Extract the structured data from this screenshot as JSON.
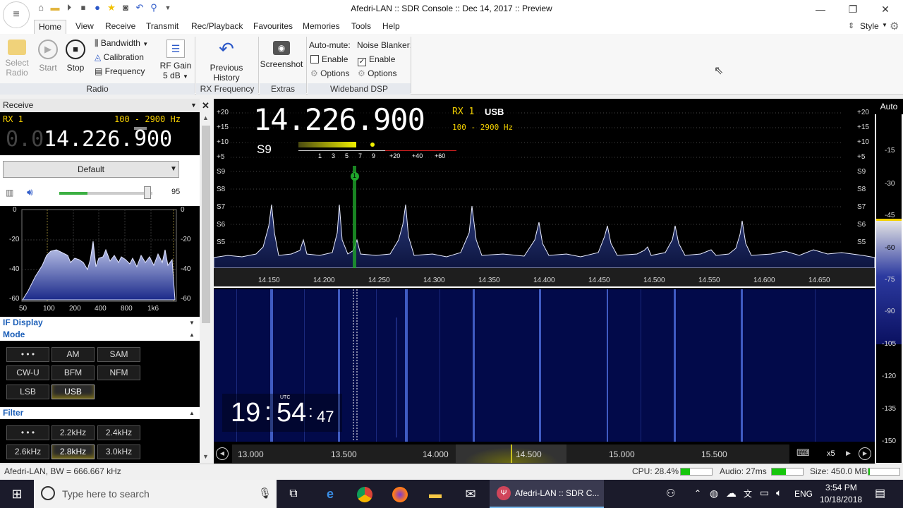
{
  "window": {
    "title": "Afedri-LAN :: SDR Console :: Dec 14, 2017 :: Preview"
  },
  "menu": {
    "tabs": [
      "Home",
      "View",
      "Receive",
      "Transmit",
      "Rec/Playback",
      "Favourites",
      "Memories",
      "Tools",
      "Help"
    ],
    "style_label": "Style"
  },
  "ribbon": {
    "select_radio": "Select\nRadio",
    "start": "Start",
    "stop": "Stop",
    "bandwidth": "Bandwidth",
    "calibration": "Calibration",
    "frequency": "Frequency",
    "rf_gain": "RF Gain",
    "rf_gain_value": "5 dB",
    "previous_history": "Previous History",
    "screenshot": "Screenshot",
    "auto_mute": "Auto-mute:",
    "noise_blanker": "Noise Blanker:",
    "enable": "Enable",
    "options": "Options",
    "group_radio": "Radio",
    "group_rxfreq": "RX Frequency",
    "group_extras": "Extras",
    "group_dsp": "Wideband DSP"
  },
  "receive": {
    "header": "Receive",
    "rx": "RX 1",
    "bw": "100 - 2900 Hz",
    "freq_dim": "0.0",
    "freq_main": "14.226.",
    "freq_cursor": "9",
    "freq_tail": "00",
    "preset": "Default",
    "volume": "95",
    "audio_y": [
      "0",
      "-20",
      "-40",
      "-60"
    ],
    "audio_x": [
      "50",
      "100",
      "200",
      "400",
      "800",
      "1k6"
    ]
  },
  "sections": {
    "if_display": "IF Display",
    "mode": "Mode",
    "filter": "Filter"
  },
  "modes": [
    "• • •",
    "AM",
    "SAM",
    "CW-U",
    "BFM",
    "NFM",
    "LSB",
    "USB"
  ],
  "filters": [
    "• • •",
    "2.2kHz",
    "2.4kHz",
    "2.6kHz",
    "2.8kHz",
    "3.0kHz"
  ],
  "display": {
    "freq": "14.226.900",
    "rx": "RX 1",
    "mode": "USB",
    "bw": "100 - 2900 Hz",
    "smeter": "S9",
    "smeter_ticks": [
      "1",
      "3",
      "5",
      "7",
      "9",
      "+20",
      "+40",
      "+60"
    ],
    "level_left": [
      "+20",
      "+15",
      "+10",
      "+5",
      "S9",
      "S8",
      "S7",
      "S6",
      "S5"
    ],
    "level_right": [
      "+20",
      "+15",
      "+10",
      "+5",
      "S9",
      "S8",
      "S7",
      "S6",
      "S5"
    ],
    "freq_axis": [
      "14.150",
      "14.200",
      "14.250",
      "14.300",
      "14.350",
      "14.400",
      "14.450",
      "14.500",
      "14.550",
      "14.600",
      "14.650"
    ],
    "marker": "1",
    "time_h": "19",
    "time_m": "54",
    "time_s": "47",
    "time_zone": "UTC",
    "span_axis": [
      "13.000",
      "13.500",
      "14.000",
      "14.500",
      "15.000",
      "15.500"
    ],
    "zoom": "x5"
  },
  "scale": {
    "auto": "Auto",
    "ticks": [
      "-15",
      "-30",
      "-45",
      "-60",
      "-75",
      "-90",
      "-105",
      "-120",
      "-135",
      "-150"
    ]
  },
  "status": {
    "left": "Afedri-LAN, BW = 666.667 kHz",
    "cpu": "CPU: 28.4%",
    "audio": "Audio: 27ms",
    "size": "Size: 450.0 MB"
  },
  "taskbar": {
    "search": "Type here to search",
    "app": "Afedri-LAN :: SDR C...",
    "lang": "ENG",
    "time": "3:54 PM",
    "date": "10/18/2018"
  }
}
